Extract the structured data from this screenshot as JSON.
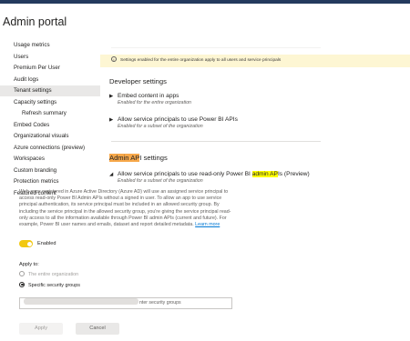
{
  "page": {
    "title": "Admin portal"
  },
  "sidebar": {
    "items": [
      {
        "label": "Usage metrics"
      },
      {
        "label": "Users"
      },
      {
        "label": "Premium Per User"
      },
      {
        "label": "Audit logs"
      },
      {
        "label": "Tenant settings",
        "active": true
      },
      {
        "label": "Capacity settings"
      },
      {
        "label": "Refresh summary",
        "sub": true
      },
      {
        "label": "Embed Codes"
      },
      {
        "label": "Organizational visuals"
      },
      {
        "label": "Azure connections (preview)"
      },
      {
        "label": "Workspaces"
      },
      {
        "label": "Custom branding"
      },
      {
        "label": "Protection metrics"
      },
      {
        "label": "Featured content"
      }
    ]
  },
  "banner": {
    "icon": "info-icon",
    "text": "Settings enabled for the entire organization apply to all users and service principals"
  },
  "developer": {
    "title": "Developer settings",
    "settings": [
      {
        "name": "Embed content in apps",
        "sub": "Enabled for the entire organization",
        "state": "collapsed"
      },
      {
        "name": "Allow service principals to use Power BI APIs",
        "sub": "Enabled for a subset of the organization",
        "state": "collapsed"
      }
    ]
  },
  "admin_api": {
    "title_highlight": "Admin AP",
    "title_rest": "I settings",
    "setting_name_pre": "Allow service principals to use read-only Power BI ",
    "setting_name_highlight": "admin AP",
    "setting_name_post": "Is (Preview)",
    "setting_sub": "Enabled for a subset of the organization",
    "description": "Web apps registered in Azure Active Directory (Azure AD) will use an assigned service principal to access read-only Power BI Admin APIs without a signed in user. To allow an app to use service principal authentication, its service principal must be included in an allowed security group. By including the service principal in the allowed security group, you're giving the service principal read-only access to all the information available through Power BI admin APIs (current and future). For example, Power BI user names and emails, dataset and report detailed metadata.",
    "learn_more": "Learn more",
    "toggle_label": "Enabled",
    "toggle_on": true,
    "apply_to_label": "Apply to:",
    "radio_options": [
      {
        "label": "The entire organization",
        "checked": false,
        "disabled": true
      },
      {
        "label": "Specific security groups",
        "checked": true,
        "disabled": false
      }
    ],
    "group_input_text": "nter security groups",
    "apply_label": "Apply",
    "cancel_label": "Cancel"
  },
  "colors": {
    "accent_toggle": "#f2c811",
    "banner_bg": "#fdf6d3",
    "highlight_orange": "#f7a84a",
    "highlight_yellow": "#ffff00",
    "topbar": "#243a5e"
  }
}
